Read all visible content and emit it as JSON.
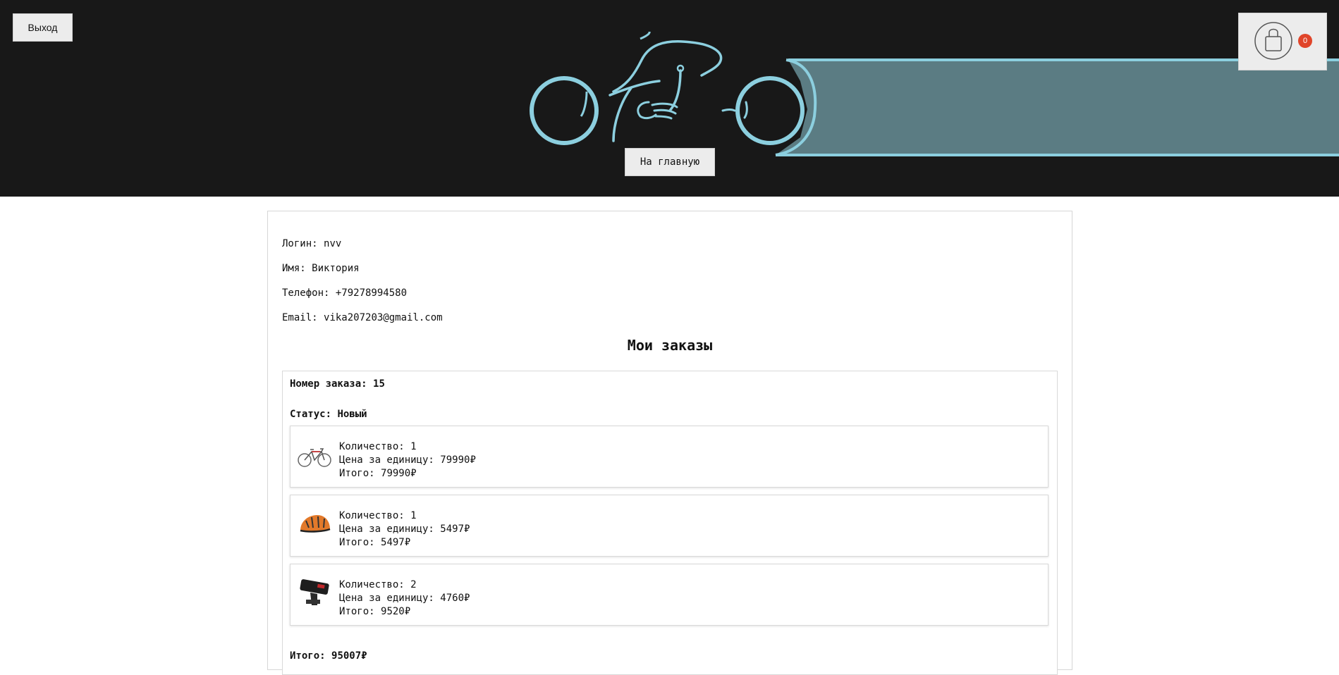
{
  "header": {
    "logout_label": "Выход",
    "home_label": "На главную",
    "cart_count": "0",
    "colors": {
      "background": "#181818",
      "accent": "#8ccfdf",
      "trail": "#5b7c83"
    },
    "logo_icon": "motorcycle-logo",
    "cart_icon": "shopping-bag-icon"
  },
  "profile": {
    "login_label": "Логин: ",
    "login": "nvv",
    "name_label": "Имя: ",
    "name": "Виктория",
    "phone_label": "Телефон: ",
    "phone": "+79278994580",
    "email_label": "Email: ",
    "email": "vika207203@gmail.com"
  },
  "orders_title": "Мои заказы",
  "order": {
    "number_label": "Номер заказа: ",
    "number": "15",
    "status_label": "Статус: ",
    "status": "Новый",
    "items": [
      {
        "image": "bicycle-image",
        "qty_label": "Количество: ",
        "qty": "1",
        "price_label": "Цена за единицу: ",
        "price": "79990₽",
        "total_label": "Итого: ",
        "total": "79990₽"
      },
      {
        "image": "helmet-image",
        "qty_label": "Количество: ",
        "qty": "1",
        "price_label": "Цена за единицу: ",
        "price": "5497₽",
        "total_label": "Итого: ",
        "total": "5497₽"
      },
      {
        "image": "bike-light-image",
        "qty_label": "Количество: ",
        "qty": "2",
        "price_label": "Цена за единицу: ",
        "price": "4760₽",
        "total_label": "Итого: ",
        "total": "9520₽"
      }
    ],
    "grand_total_label": "Итого: ",
    "grand_total": "95007₽"
  }
}
